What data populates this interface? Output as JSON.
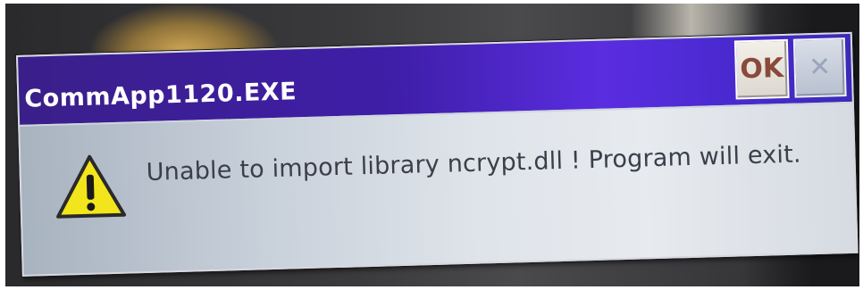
{
  "dialog": {
    "title": "CommApp1120.EXE",
    "ok_label": "OK",
    "close_label": "✕",
    "message": "Unable to import library ncrypt.dll ! Program will exit.",
    "icon": "warning-icon"
  },
  "colors": {
    "titlebar": "#4a24c4",
    "body": "#dde2e8",
    "warning": "#f2e51c"
  }
}
